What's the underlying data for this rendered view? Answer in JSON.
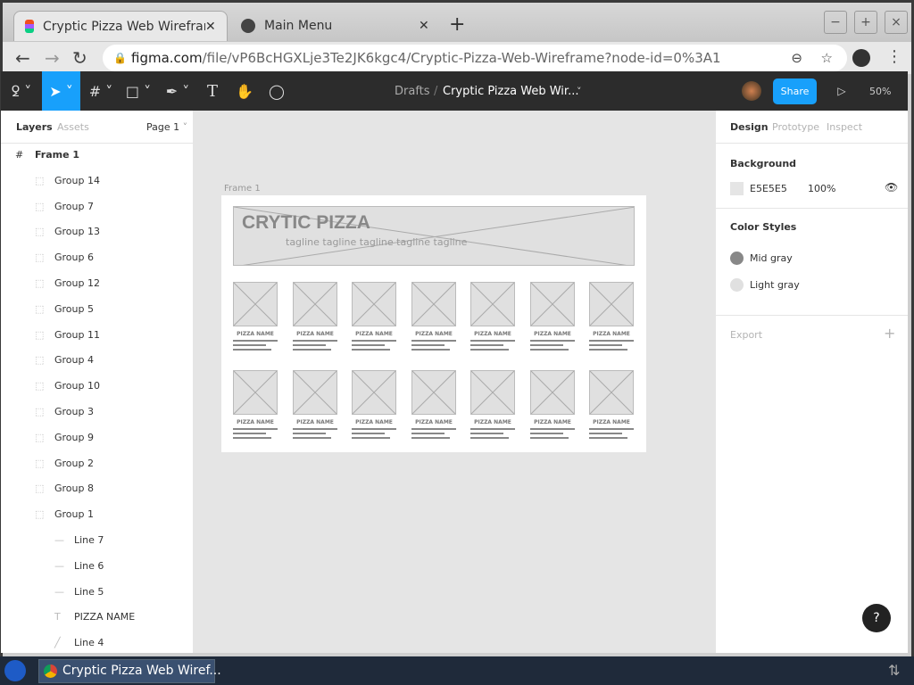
{
  "browser": {
    "tabs": [
      {
        "title": "Cryptic Pizza Web Wireframe",
        "icon": "figma-icon"
      },
      {
        "title": "Main Menu",
        "icon": "globe-icon"
      }
    ],
    "new_tab": "+",
    "win": {
      "min": "−",
      "max": "+",
      "close": "×"
    },
    "url_domain": "figma.com",
    "url_path": "/file/vP6BcHGXLje3Te2JK6kgc4/Cryptic-Pizza-Web-Wireframe?node-id=0%3A1"
  },
  "figma": {
    "breadcrumb_root": "Drafts",
    "breadcrumb_sep": "/",
    "file_name": "Cryptic Pizza Web Wir...",
    "share": "Share",
    "zoom": "50%",
    "accent": "#18a0fb"
  },
  "left": {
    "tabs": [
      "Layers",
      "Assets"
    ],
    "page": "Page 1",
    "layers": [
      {
        "name": "Frame 1",
        "type": "frame"
      },
      {
        "name": "Group 14",
        "type": "group"
      },
      {
        "name": "Group 7",
        "type": "group"
      },
      {
        "name": "Group 13",
        "type": "group"
      },
      {
        "name": "Group 6",
        "type": "group"
      },
      {
        "name": "Group 12",
        "type": "group"
      },
      {
        "name": "Group 5",
        "type": "group"
      },
      {
        "name": "Group 11",
        "type": "group"
      },
      {
        "name": "Group 4",
        "type": "group"
      },
      {
        "name": "Group 10",
        "type": "group"
      },
      {
        "name": "Group 3",
        "type": "group"
      },
      {
        "name": "Group 9",
        "type": "group"
      },
      {
        "name": "Group 2",
        "type": "group"
      },
      {
        "name": "Group 8",
        "type": "group"
      },
      {
        "name": "Group 1",
        "type": "group"
      },
      {
        "name": "Line 7",
        "type": "line"
      },
      {
        "name": "Line 6",
        "type": "line"
      },
      {
        "name": "Line 5",
        "type": "line"
      },
      {
        "name": "PIZZA NAME",
        "type": "text"
      },
      {
        "name": "Line 4",
        "type": "diag"
      }
    ]
  },
  "canvas": {
    "frame_label": "Frame 1",
    "title": "CRYTIC PIZZA",
    "tagline": "tagline tagline tagline tagline tagline",
    "card_label": "PIZZA NAME",
    "rows": 2,
    "cols": 7
  },
  "right": {
    "tabs": [
      "Design",
      "Prototype",
      "Inspect"
    ],
    "background_label": "Background",
    "bg_hex": "E5E5E5",
    "bg_opacity": "100%",
    "color_styles_label": "Color Styles",
    "styles": [
      {
        "name": "Mid gray",
        "color": "#888888"
      },
      {
        "name": "Light gray",
        "color": "#e0e0e0"
      }
    ],
    "export": "Export"
  },
  "help": "?",
  "taskbar": {
    "window": "Cryptic Pizza Web Wiref..."
  }
}
